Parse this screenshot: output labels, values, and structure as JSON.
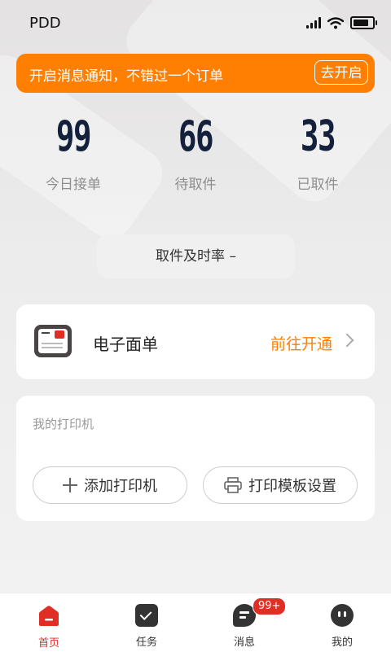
{
  "status_bar": {
    "carrier": "PDD"
  },
  "notice": {
    "text": "开启消息通知，不错过一个订单",
    "button": "去开启"
  },
  "stats": [
    {
      "value": "99",
      "label": "今日接单"
    },
    {
      "value": "66",
      "label": "待取件"
    },
    {
      "value": "33",
      "label": "已取件"
    }
  ],
  "pickup_rate": {
    "text": "取件及时率 –"
  },
  "waybill": {
    "title": "电子面单",
    "action": "前往开通"
  },
  "printer": {
    "title": "我的打印机",
    "add_button": "添加打印机",
    "template_button": "打印模板设置"
  },
  "tabbar": {
    "items": [
      {
        "label": "首页",
        "icon": "home-icon",
        "active": true
      },
      {
        "label": "任务",
        "icon": "task-icon"
      },
      {
        "label": "消息",
        "icon": "message-icon",
        "badge": "99+"
      },
      {
        "label": "我的",
        "icon": "profile-icon"
      }
    ]
  },
  "colors": {
    "accent": "#fe7f02",
    "brand_red": "#e02e24",
    "stat_number": "#14213d"
  }
}
